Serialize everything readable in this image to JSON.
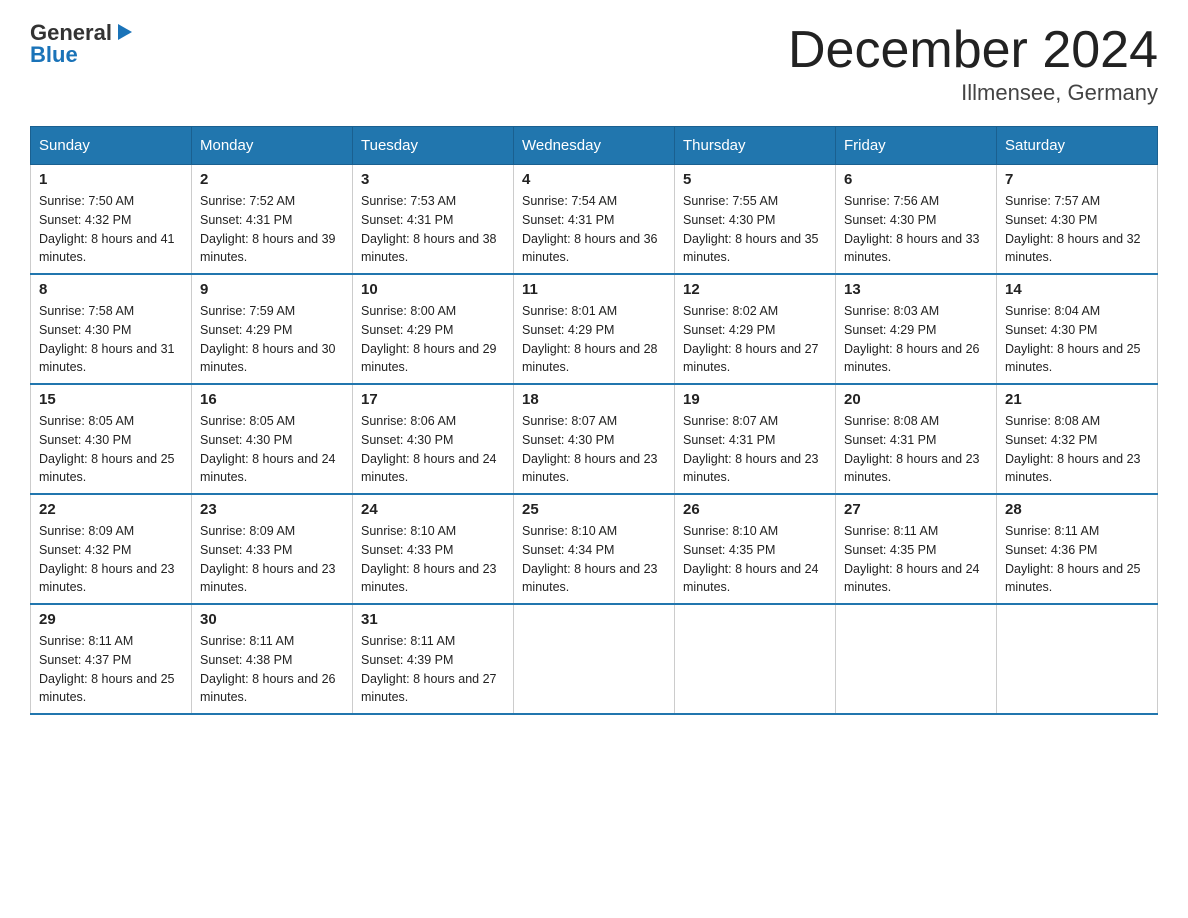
{
  "logo": {
    "line1": "General",
    "arrow": "▶",
    "line2": "Blue"
  },
  "title": "December 2024",
  "location": "Illmensee, Germany",
  "days_of_week": [
    "Sunday",
    "Monday",
    "Tuesday",
    "Wednesday",
    "Thursday",
    "Friday",
    "Saturday"
  ],
  "weeks": [
    [
      {
        "day": "1",
        "sunrise": "7:50 AM",
        "sunset": "4:32 PM",
        "daylight": "8 hours and 41 minutes."
      },
      {
        "day": "2",
        "sunrise": "7:52 AM",
        "sunset": "4:31 PM",
        "daylight": "8 hours and 39 minutes."
      },
      {
        "day": "3",
        "sunrise": "7:53 AM",
        "sunset": "4:31 PM",
        "daylight": "8 hours and 38 minutes."
      },
      {
        "day": "4",
        "sunrise": "7:54 AM",
        "sunset": "4:31 PM",
        "daylight": "8 hours and 36 minutes."
      },
      {
        "day": "5",
        "sunrise": "7:55 AM",
        "sunset": "4:30 PM",
        "daylight": "8 hours and 35 minutes."
      },
      {
        "day": "6",
        "sunrise": "7:56 AM",
        "sunset": "4:30 PM",
        "daylight": "8 hours and 33 minutes."
      },
      {
        "day": "7",
        "sunrise": "7:57 AM",
        "sunset": "4:30 PM",
        "daylight": "8 hours and 32 minutes."
      }
    ],
    [
      {
        "day": "8",
        "sunrise": "7:58 AM",
        "sunset": "4:30 PM",
        "daylight": "8 hours and 31 minutes."
      },
      {
        "day": "9",
        "sunrise": "7:59 AM",
        "sunset": "4:29 PM",
        "daylight": "8 hours and 30 minutes."
      },
      {
        "day": "10",
        "sunrise": "8:00 AM",
        "sunset": "4:29 PM",
        "daylight": "8 hours and 29 minutes."
      },
      {
        "day": "11",
        "sunrise": "8:01 AM",
        "sunset": "4:29 PM",
        "daylight": "8 hours and 28 minutes."
      },
      {
        "day": "12",
        "sunrise": "8:02 AM",
        "sunset": "4:29 PM",
        "daylight": "8 hours and 27 minutes."
      },
      {
        "day": "13",
        "sunrise": "8:03 AM",
        "sunset": "4:29 PM",
        "daylight": "8 hours and 26 minutes."
      },
      {
        "day": "14",
        "sunrise": "8:04 AM",
        "sunset": "4:30 PM",
        "daylight": "8 hours and 25 minutes."
      }
    ],
    [
      {
        "day": "15",
        "sunrise": "8:05 AM",
        "sunset": "4:30 PM",
        "daylight": "8 hours and 25 minutes."
      },
      {
        "day": "16",
        "sunrise": "8:05 AM",
        "sunset": "4:30 PM",
        "daylight": "8 hours and 24 minutes."
      },
      {
        "day": "17",
        "sunrise": "8:06 AM",
        "sunset": "4:30 PM",
        "daylight": "8 hours and 24 minutes."
      },
      {
        "day": "18",
        "sunrise": "8:07 AM",
        "sunset": "4:30 PM",
        "daylight": "8 hours and 23 minutes."
      },
      {
        "day": "19",
        "sunrise": "8:07 AM",
        "sunset": "4:31 PM",
        "daylight": "8 hours and 23 minutes."
      },
      {
        "day": "20",
        "sunrise": "8:08 AM",
        "sunset": "4:31 PM",
        "daylight": "8 hours and 23 minutes."
      },
      {
        "day": "21",
        "sunrise": "8:08 AM",
        "sunset": "4:32 PM",
        "daylight": "8 hours and 23 minutes."
      }
    ],
    [
      {
        "day": "22",
        "sunrise": "8:09 AM",
        "sunset": "4:32 PM",
        "daylight": "8 hours and 23 minutes."
      },
      {
        "day": "23",
        "sunrise": "8:09 AM",
        "sunset": "4:33 PM",
        "daylight": "8 hours and 23 minutes."
      },
      {
        "day": "24",
        "sunrise": "8:10 AM",
        "sunset": "4:33 PM",
        "daylight": "8 hours and 23 minutes."
      },
      {
        "day": "25",
        "sunrise": "8:10 AM",
        "sunset": "4:34 PM",
        "daylight": "8 hours and 23 minutes."
      },
      {
        "day": "26",
        "sunrise": "8:10 AM",
        "sunset": "4:35 PM",
        "daylight": "8 hours and 24 minutes."
      },
      {
        "day": "27",
        "sunrise": "8:11 AM",
        "sunset": "4:35 PM",
        "daylight": "8 hours and 24 minutes."
      },
      {
        "day": "28",
        "sunrise": "8:11 AM",
        "sunset": "4:36 PM",
        "daylight": "8 hours and 25 minutes."
      }
    ],
    [
      {
        "day": "29",
        "sunrise": "8:11 AM",
        "sunset": "4:37 PM",
        "daylight": "8 hours and 25 minutes."
      },
      {
        "day": "30",
        "sunrise": "8:11 AM",
        "sunset": "4:38 PM",
        "daylight": "8 hours and 26 minutes."
      },
      {
        "day": "31",
        "sunrise": "8:11 AM",
        "sunset": "4:39 PM",
        "daylight": "8 hours and 27 minutes."
      },
      null,
      null,
      null,
      null
    ]
  ],
  "labels": {
    "sunrise_prefix": "Sunrise: ",
    "sunset_prefix": "Sunset: ",
    "daylight_prefix": "Daylight: "
  }
}
